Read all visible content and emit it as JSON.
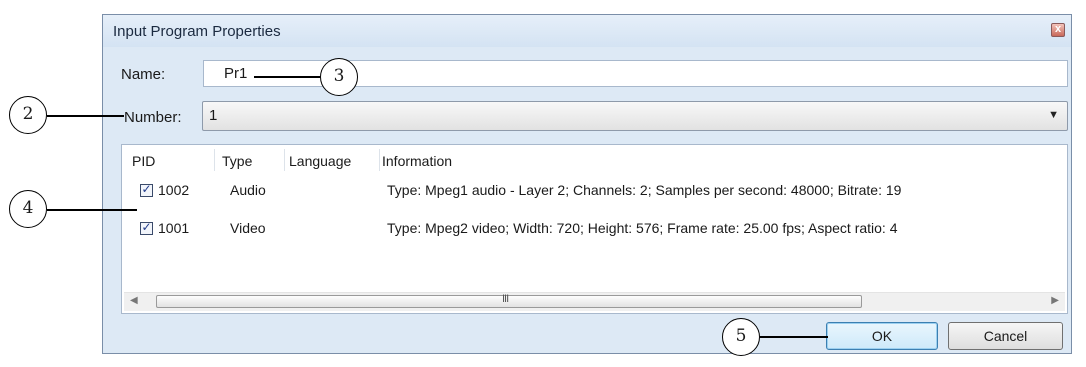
{
  "dialog": {
    "title": "Input Program Properties",
    "close_glyph": "x"
  },
  "form": {
    "name_label": "Name:",
    "name_value": "Pr1",
    "number_label": "Number:",
    "number_value": "1"
  },
  "list": {
    "columns": [
      "PID",
      "Type",
      "Language",
      "Information"
    ],
    "rows": [
      {
        "checked": true,
        "pid": "1002",
        "type": "Audio",
        "language": "",
        "information": "Type: Mpeg1 audio - Layer 2; Channels: 2; Samples per second: 48000; Bitrate: 19"
      },
      {
        "checked": true,
        "pid": "1001",
        "type": "Video",
        "language": "",
        "information": "Type: Mpeg2 video; Width: 720; Height: 576; Frame rate: 25.00 fps; Aspect ratio: 4"
      }
    ]
  },
  "buttons": {
    "ok_label": "OK",
    "cancel_label": "Cancel"
  },
  "callouts": [
    "2",
    "3",
    "4",
    "5"
  ]
}
